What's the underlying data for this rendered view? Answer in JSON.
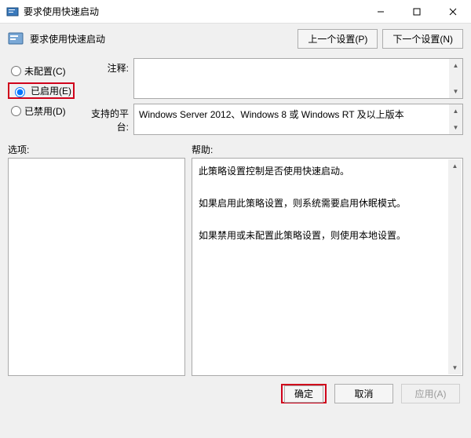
{
  "window": {
    "title": "要求使用快速启动",
    "subtitle": "要求使用快速启动"
  },
  "nav": {
    "prev": "上一个设置(P)",
    "next": "下一个设置(N)"
  },
  "radios": {
    "not_configured": "未配置(C)",
    "enabled": "已启用(E)",
    "disabled": "已禁用(D)"
  },
  "fields": {
    "comment_label": "注释:",
    "platform_label": "支持的平台:",
    "platform_text": "Windows Server 2012、Windows 8 或 Windows RT 及以上版本"
  },
  "columns": {
    "options": "选项:",
    "help": "帮助:"
  },
  "help": {
    "p1": "此策略设置控制是否使用快速启动。",
    "p2": "如果启用此策略设置，则系统需要启用休眠模式。",
    "p3": "如果禁用或未配置此策略设置，则使用本地设置。"
  },
  "buttons": {
    "ok": "确定",
    "cancel": "取消",
    "apply": "应用(A)"
  }
}
